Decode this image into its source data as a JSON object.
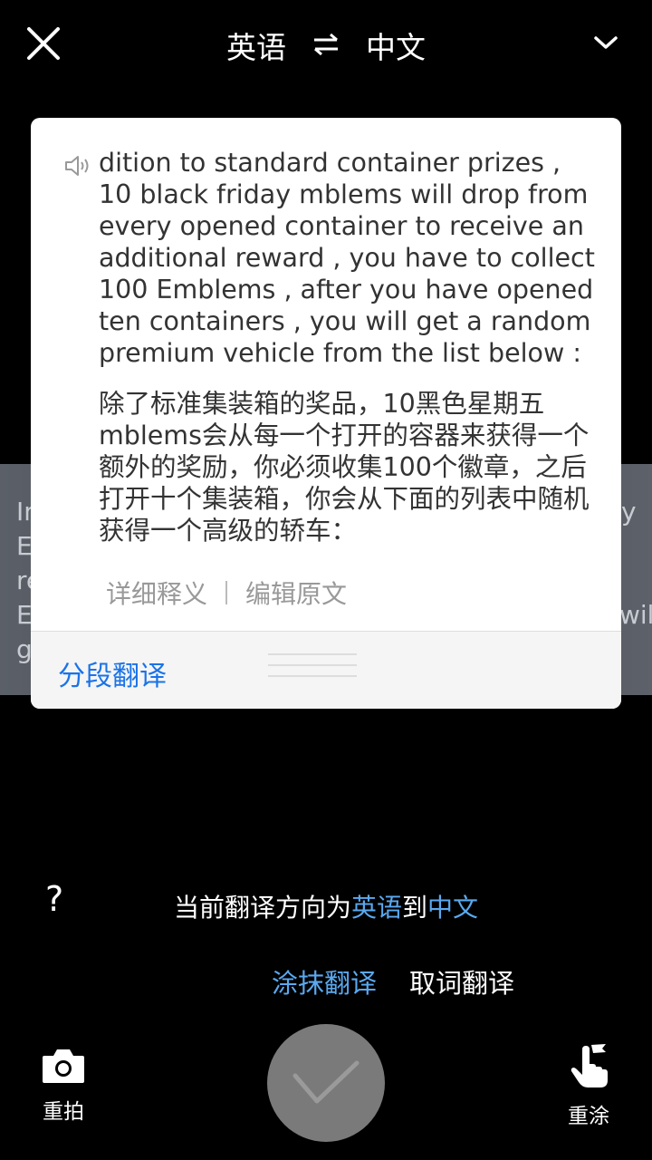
{
  "header": {
    "source_lang": "英语",
    "target_lang": "中文"
  },
  "background_fragments": [
    "In",
    "E",
    "re",
    "E",
    "g",
    "y",
    "will"
  ],
  "card": {
    "source_text": "dition to standard container prizes , 10 black friday mblems will drop from every opened container to receive an additional reward , you have to collect 100 Emblems , after you have opened ten containers , you will get a random premium vehicle from the list below :",
    "translated_text": "除了标准集装箱的奖品，10黑色星期五mblems会从每一个打开的容器来获得一个额外的奖励，你必须收集100个徽章，之后打开十个集装箱，你会从下面的列表中随机获得一个高级的轿车：",
    "detail_link": "详细释义",
    "edit_link": "编辑原文",
    "segment_button": "分段翻译"
  },
  "direction": {
    "prefix": "当前翻译方向为",
    "from": "英语",
    "middle": "到",
    "to": "中文"
  },
  "help_label": "?",
  "modes": {
    "smear": "涂抹翻译",
    "word": "取词翻译"
  },
  "actions": {
    "retake": "重拍",
    "repaint": "重涂"
  },
  "colors": {
    "accent_blue": "#5aa9f0",
    "link_blue": "#1a73e8",
    "shutter_gray": "#7a7a7a"
  }
}
